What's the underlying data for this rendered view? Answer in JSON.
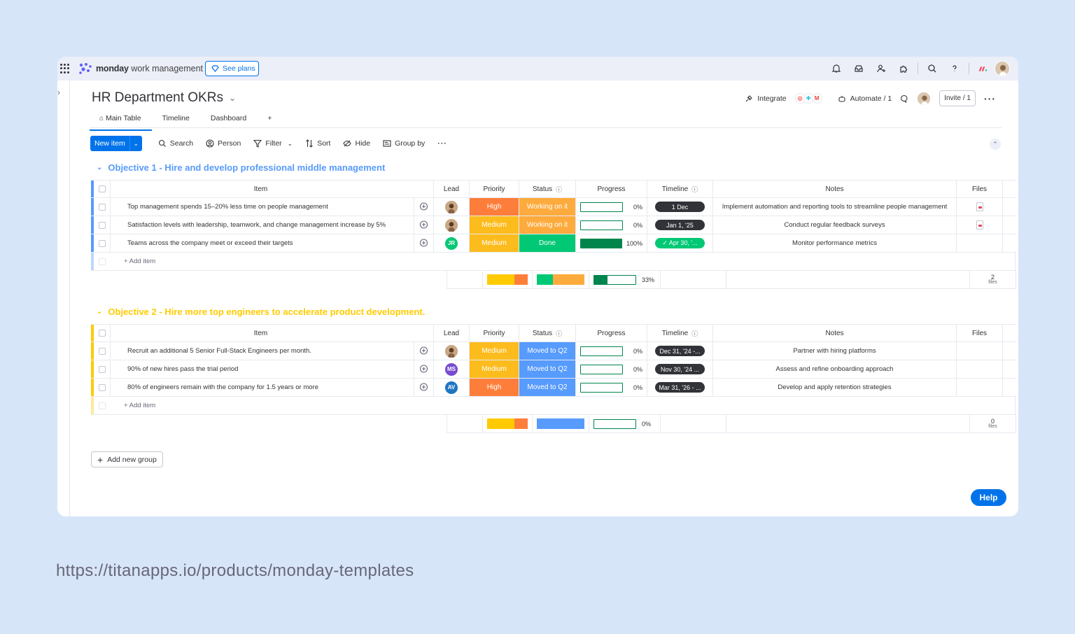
{
  "brand": {
    "name_bold": "monday",
    "name_light": " work management",
    "see_plans": "See plans"
  },
  "colors": {
    "accent": "#0073ea",
    "group1": "#579bfc",
    "group2": "#ffcb00",
    "high": "#fd7e3a",
    "medium": "#fdbc1d",
    "working": "#fdab3d",
    "done": "#00c875",
    "moved": "#579bfc"
  },
  "board": {
    "title": "HR Department OKRs",
    "tabs": [
      "Main Table",
      "Timeline",
      "Dashboard",
      "+"
    ]
  },
  "header_right": {
    "integrate": "Integrate",
    "automate": "Automate / 1",
    "invite": "Invite / 1"
  },
  "toolbar": {
    "new_item": "New item",
    "search": "Search",
    "person": "Person",
    "filter": "Filter",
    "sort": "Sort",
    "hide": "Hide",
    "group_by": "Group by"
  },
  "columns": {
    "item": "Item",
    "lead": "Lead",
    "priority": "Priority",
    "status": "Status",
    "progress": "Progress",
    "timeline": "Timeline",
    "notes": "Notes",
    "files": "Files"
  },
  "groups": [
    {
      "title": "Objective 1 - Hire and develop professional middle management",
      "rows": [
        {
          "item": "Top management spends 15–20% less time on people management",
          "lead": "",
          "priority": "High",
          "status": "Working on it",
          "progress": 0,
          "progress_label": "0%",
          "timeline": "1 Dec",
          "notes": "Implement automation and reporting tools to streamline people management"
        },
        {
          "item": "Satisfaction levels with leadership, teamwork, and change management increase by 5%",
          "lead": "",
          "priority": "Medium",
          "status": "Working on it",
          "progress": 0,
          "progress_label": "0%",
          "timeline": "Jan 1, '25",
          "notes": "Conduct regular feedback surveys"
        },
        {
          "item": "Teams across the company meet or exceed their targets",
          "lead": "JR",
          "priority": "Medium",
          "status": "Done",
          "progress": 100,
          "progress_label": "100%",
          "timeline": "✓ Apr 30, '...",
          "notes": "Monitor performance metrics"
        }
      ],
      "add_item": "+ Add item",
      "summary": {
        "progress": 33,
        "progress_label": "33%",
        "files_count": "2",
        "files_unit": "files"
      }
    },
    {
      "title": "Objective 2 - Hire more top engineers to accelerate product development.",
      "rows": [
        {
          "item": "Recruit an additional 5 Senior Full-Stack Engineers per month.",
          "lead": "",
          "priority": "Medium",
          "status": "Moved to Q2",
          "progress": 0,
          "progress_label": "0%",
          "timeline": "Dec 31, '24 -...",
          "notes": "Partner with hiring platforms"
        },
        {
          "item": "90% of new hires pass the trial period",
          "lead": "MS",
          "priority": "Medium",
          "status": "Moved to Q2",
          "progress": 0,
          "progress_label": "0%",
          "timeline": "Nov 30, '24 ...",
          "notes": "Assess and refine onboarding approach"
        },
        {
          "item": "80% of engineers remain with the company for 1.5 years or more",
          "lead": "AV",
          "priority": "High",
          "status": "Moved to Q2",
          "progress": 0,
          "progress_label": "0%",
          "timeline": "Mar 31, '26 - ...",
          "notes": "Develop and apply retention strategies"
        }
      ],
      "add_item": "+ Add item",
      "summary": {
        "progress": 0,
        "progress_label": "0%",
        "files_count": "0",
        "files_unit": "files"
      }
    }
  ],
  "add_group": "Add new group",
  "help": "Help",
  "footer_url": "https://titanapps.io/products/monday-templates"
}
